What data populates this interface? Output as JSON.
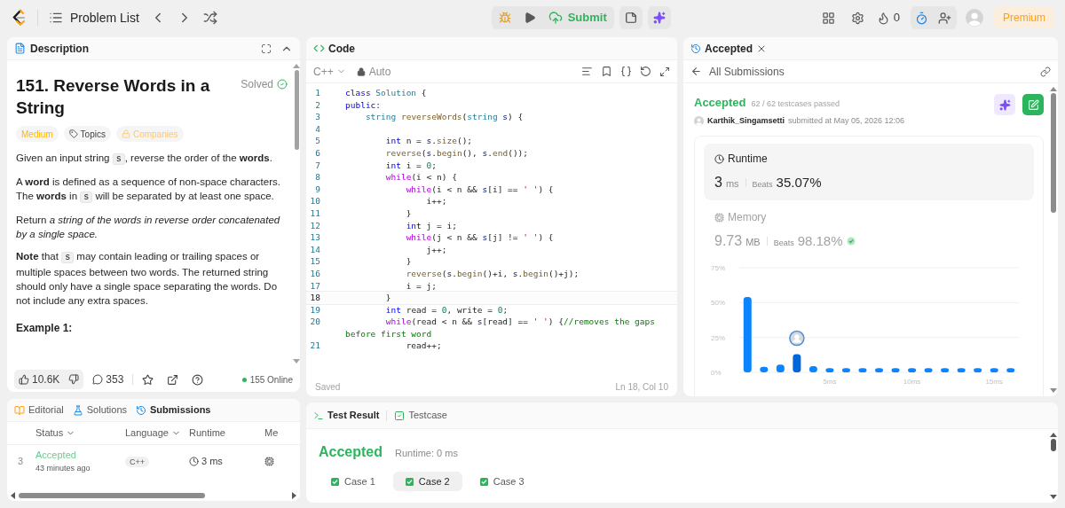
{
  "top_bar": {
    "problem_list": "Problem List",
    "submit": "Submit",
    "streak": "0",
    "premium": "Premium"
  },
  "description": {
    "tab": "Description",
    "title": "151. Reverse Words in a String",
    "status": "Solved",
    "tags": [
      {
        "label": "Medium",
        "kind": "difficulty"
      },
      {
        "label": "Topics",
        "kind": "topics"
      },
      {
        "label": "Companies",
        "kind": "companies"
      }
    ],
    "paragraphs": [
      [
        {
          "kind": "text",
          "text": "Given an input string "
        },
        {
          "kind": "code",
          "text": "s"
        },
        {
          "kind": "text",
          "text": ", reverse the order of the **words**."
        }
      ],
      [
        {
          "kind": "text",
          "text": "A **word** is defined as a sequence of non-space characters. The **words** in "
        },
        {
          "kind": "code",
          "text": "s"
        },
        {
          "kind": "text",
          "text": " will be separated by at least one space."
        }
      ],
      [
        {
          "kind": "text",
          "text": "Return *a string of the words in reverse order concatenated by a single space.*"
        }
      ],
      [
        {
          "kind": "text",
          "text": "**Note** that "
        },
        {
          "kind": "code",
          "text": "s"
        },
        {
          "kind": "text",
          "text": " may contain leading or trailing spaces or multiple spaces between two words. The returned string should only have a single space separating the words. Do not include any extra spaces."
        }
      ]
    ],
    "example_heading": "Example 1:",
    "likes": "10.6K",
    "comments": "353",
    "online": "155 Online"
  },
  "code": {
    "tab": "Code",
    "language": "C++",
    "mode": "Auto",
    "status": "Saved",
    "cursor": "Ln 18, Col 10",
    "lines": [
      {
        "number": "1",
        "current": false,
        "tokens": [
          {
            "kind": "kw",
            "text": "class"
          },
          {
            "kind": "type",
            "text": " Solution"
          },
          {
            "kind": "txt",
            "text": " {"
          }
        ]
      },
      {
        "number": "2",
        "current": false,
        "tokens": [
          {
            "kind": "kw",
            "text": "public:"
          }
        ]
      },
      {
        "number": "3",
        "current": false,
        "tokens": [
          {
            "kind": "type",
            "text": "    string"
          },
          {
            "kind": "fn",
            "text": " reverseWords"
          },
          {
            "kind": "txt",
            "text": "("
          },
          {
            "kind": "type",
            "text": "string"
          },
          {
            "kind": "var",
            "text": " s"
          },
          {
            "kind": "txt",
            "text": ") {"
          }
        ]
      },
      {
        "number": "4",
        "current": false
      },
      {
        "number": "5",
        "current": false,
        "tokens": [
          {
            "kind": "kw",
            "text": "        int"
          },
          {
            "kind": "txt",
            "text": " n = "
          },
          {
            "kind": "var",
            "text": "s"
          },
          {
            "kind": "txt",
            "text": "."
          },
          {
            "kind": "fn",
            "text": "size"
          },
          {
            "kind": "txt",
            "text": "();"
          }
        ]
      },
      {
        "number": "6",
        "current": false,
        "tokens": [
          {
            "kind": "fn",
            "text": "        reverse"
          },
          {
            "kind": "txt",
            "text": "("
          },
          {
            "kind": "var",
            "text": "s"
          },
          {
            "kind": "txt",
            "text": "."
          },
          {
            "kind": "fn",
            "text": "begin"
          },
          {
            "kind": "txt",
            "text": "(), "
          },
          {
            "kind": "var",
            "text": "s"
          },
          {
            "kind": "txt",
            "text": "."
          },
          {
            "kind": "fn",
            "text": "end"
          },
          {
            "kind": "txt",
            "text": "());"
          }
        ]
      },
      {
        "number": "7",
        "current": false,
        "tokens": [
          {
            "kind": "kw",
            "text": "        int"
          },
          {
            "kind": "txt",
            "text": " i = "
          },
          {
            "kind": "num",
            "text": "0"
          },
          {
            "kind": "txt",
            "text": ";"
          }
        ]
      },
      {
        "number": "8",
        "current": false,
        "tokens": [
          {
            "kind": "ctl",
            "text": "        while"
          },
          {
            "kind": "txt",
            "text": "(i < n) {"
          }
        ]
      },
      {
        "number": "9",
        "current": false,
        "tokens": [
          {
            "kind": "ctl",
            "text": "            while"
          },
          {
            "kind": "txt",
            "text": "(i < n && "
          },
          {
            "kind": "var",
            "text": "s"
          },
          {
            "kind": "txt",
            "text": "[i] == "
          },
          {
            "kind": "str",
            "text": "' '"
          },
          {
            "kind": "txt",
            "text": ") {"
          }
        ]
      },
      {
        "number": "10",
        "current": false,
        "tokens": [
          {
            "kind": "txt",
            "text": "                i++;"
          }
        ]
      },
      {
        "number": "11",
        "current": false,
        "tokens": [
          {
            "kind": "txt",
            "text": "            }"
          }
        ]
      },
      {
        "number": "12",
        "current": false,
        "tokens": [
          {
            "kind": "kw",
            "text": "            int"
          },
          {
            "kind": "txt",
            "text": " j = i;"
          }
        ]
      },
      {
        "number": "13",
        "current": false,
        "tokens": [
          {
            "kind": "ctl",
            "text": "            while"
          },
          {
            "kind": "txt",
            "text": "(j < n && "
          },
          {
            "kind": "var",
            "text": "s"
          },
          {
            "kind": "txt",
            "text": "[j] != "
          },
          {
            "kind": "str",
            "text": "' '"
          },
          {
            "kind": "txt",
            "text": ") {"
          }
        ]
      },
      {
        "number": "14",
        "current": false,
        "tokens": [
          {
            "kind": "txt",
            "text": "                j++;"
          }
        ]
      },
      {
        "number": "15",
        "current": false,
        "tokens": [
          {
            "kind": "txt",
            "text": "            }"
          }
        ]
      },
      {
        "number": "16",
        "current": false,
        "tokens": [
          {
            "kind": "fn",
            "text": "            reverse"
          },
          {
            "kind": "txt",
            "text": "("
          },
          {
            "kind": "var",
            "text": "s"
          },
          {
            "kind": "txt",
            "text": "."
          },
          {
            "kind": "fn",
            "text": "begin"
          },
          {
            "kind": "txt",
            "text": "()+i, "
          },
          {
            "kind": "var",
            "text": "s"
          },
          {
            "kind": "txt",
            "text": "."
          },
          {
            "kind": "fn",
            "text": "begin"
          },
          {
            "kind": "txt",
            "text": "()+j);"
          }
        ]
      },
      {
        "number": "17",
        "current": false,
        "tokens": [
          {
            "kind": "txt",
            "text": "            i = j;"
          }
        ]
      },
      {
        "number": "18",
        "current": true,
        "tokens": [
          {
            "kind": "txt",
            "text": "        }"
          }
        ]
      },
      {
        "number": "19",
        "current": false,
        "tokens": [
          {
            "kind": "kw",
            "text": "        int"
          },
          {
            "kind": "txt",
            "text": " read = "
          },
          {
            "kind": "num",
            "text": "0"
          },
          {
            "kind": "txt",
            "text": ", write = "
          },
          {
            "kind": "num",
            "text": "0"
          },
          {
            "kind": "txt",
            "text": ";"
          }
        ]
      },
      {
        "number": "20",
        "current": false,
        "tokens": [
          {
            "kind": "ctl",
            "text": "        while"
          },
          {
            "kind": "txt",
            "text": "(read < n && "
          },
          {
            "kind": "var",
            "text": "s"
          },
          {
            "kind": "txt",
            "text": "[read] == "
          },
          {
            "kind": "str",
            "text": "' '"
          },
          {
            "kind": "txt",
            "text": ") {"
          },
          {
            "kind": "com",
            "text": "//removes the gaps before first word"
          }
        ]
      },
      {
        "number": "21",
        "current": false,
        "tokens": [
          {
            "kind": "txt",
            "text": "            read++;"
          }
        ]
      }
    ]
  },
  "submission": {
    "tab": "Accepted",
    "back_link": "All Submissions",
    "verdict": "Accepted",
    "testcases": "62 / 62 testcases passed",
    "user": "Karthik_Singamsetti",
    "submitted": "submitted at May 05, 2026 12:06",
    "metrics": [
      {
        "kind": "runtime",
        "label": "Runtime",
        "value": "3",
        "unit": "ms",
        "beats_label": "Beats",
        "beats": "35.07%",
        "selected": true
      },
      {
        "kind": "memory",
        "label": "Memory",
        "value": "9.73",
        "unit": "MB",
        "beats_label": "Beats",
        "beats": "98.18%",
        "selected": false
      }
    ],
    "chart_data": {
      "type": "bar",
      "x": [
        0,
        1,
        2,
        3,
        4,
        5,
        6,
        7,
        8,
        9,
        10,
        11,
        12,
        13,
        14,
        15,
        16
      ],
      "values": [
        54,
        4,
        5.5,
        13,
        4.5,
        3,
        3,
        3,
        3,
        3,
        3,
        3,
        3,
        3,
        3,
        3,
        3
      ],
      "xlim": [
        -0.5,
        16.5
      ],
      "ylim": [
        0,
        75
      ],
      "xticks": [
        {
          "value": 5,
          "label": "5ms"
        },
        {
          "value": 10,
          "label": "10ms"
        },
        {
          "value": 15,
          "label": "15ms"
        }
      ],
      "yticks": [
        {
          "value": 0,
          "label": "0%"
        },
        {
          "value": 25,
          "label": "25%"
        },
        {
          "value": 50,
          "label": "50%"
        },
        {
          "value": 75,
          "label": "75%"
        }
      ]
    }
  },
  "bottom_left": {
    "tabs": [
      {
        "label": "Editorial",
        "selected": false
      },
      {
        "label": "Solutions",
        "selected": false
      },
      {
        "label": "Submissions",
        "selected": true
      }
    ],
    "columns": [
      "Status",
      "Language",
      "Runtime",
      "Me"
    ],
    "rows": [
      {
        "index": "3",
        "status": "Accepted",
        "time": "43 minutes ago",
        "language": "C++",
        "runtime": "3 ms"
      }
    ]
  },
  "test_result": {
    "tabs": [
      {
        "label": "Test Result",
        "selected": true
      },
      {
        "label": "Testcase",
        "selected": false
      }
    ],
    "verdict": "Accepted",
    "runtime": "Runtime: 0 ms",
    "cases": [
      {
        "label": "Case 1",
        "selected": false
      },
      {
        "label": "Case 2",
        "selected": true
      },
      {
        "label": "Case 3",
        "selected": false
      }
    ]
  }
}
